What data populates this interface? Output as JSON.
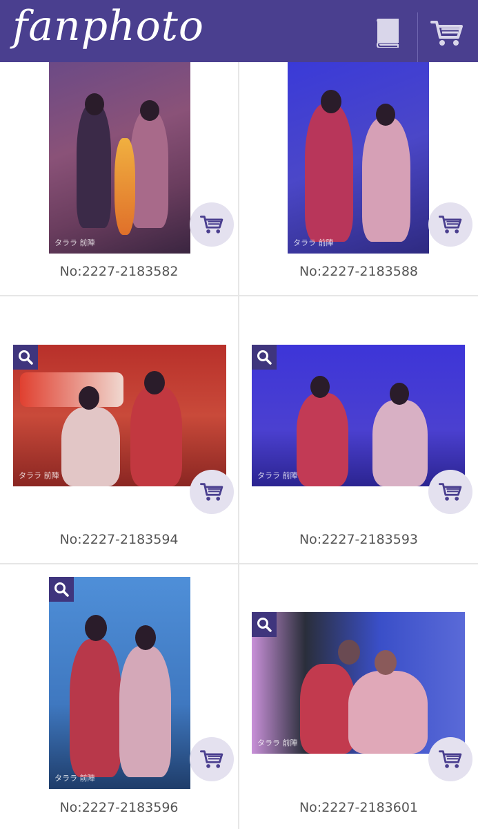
{
  "header": {
    "logo": "fanphoto",
    "book_icon": "book-icon",
    "cart_icon": "cart-icon"
  },
  "colors": {
    "brand": "#4a3f8f",
    "zoom_bg": "#3f357d",
    "cart_bg": "#e4e1ef",
    "label_text": "#555555"
  },
  "photos": [
    {
      "label": "No:2227-2183582",
      "watermark": "タララ 前陣"
    },
    {
      "label": "No:2227-2183588",
      "watermark": "タララ 前陣"
    },
    {
      "label": "No:2227-2183594",
      "watermark": "タララ 前陣"
    },
    {
      "label": "No:2227-2183593",
      "watermark": "タララ 前陣"
    },
    {
      "label": "No:2227-2183596",
      "watermark": "タララ 前陣"
    },
    {
      "label": "No:2227-2183601",
      "watermark": "タララ 前陣"
    }
  ]
}
